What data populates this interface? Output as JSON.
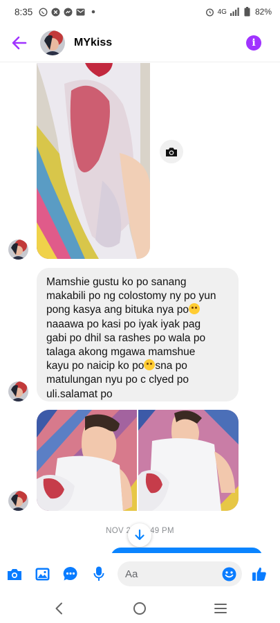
{
  "status_bar": {
    "time": "8:35",
    "network": "4G",
    "battery": "82%"
  },
  "header": {
    "contact_name": "MYkiss"
  },
  "message": {
    "lines": [
      "Mamshie gustu ko po sanang",
      "makabili po ng colostomy ny po yun",
      "pong kasya ang bituka nya po",
      "naaawa po kasi po iyak iyak pag",
      "gabi po dhil sa rashes po wala po",
      "talaga akong mgawa mamshue",
      "kayu po naicip ko po",
      "sna po",
      "matulungan nyu po c clyed po",
      "uli.salamat po"
    ]
  },
  "timestamp": "NOV 2        49 PM",
  "composer": {
    "placeholder": "Aa"
  },
  "colors": {
    "accent": "#a033ff",
    "messenger_blue": "#0a84ff"
  },
  "icons": [
    "back-arrow-icon",
    "info-icon",
    "camera-icon",
    "gallery-icon",
    "chat-bubble-icon",
    "microphone-icon",
    "emoji-icon",
    "thumbs-up-icon",
    "nav-back-icon",
    "nav-home-icon",
    "nav-menu-icon"
  ]
}
